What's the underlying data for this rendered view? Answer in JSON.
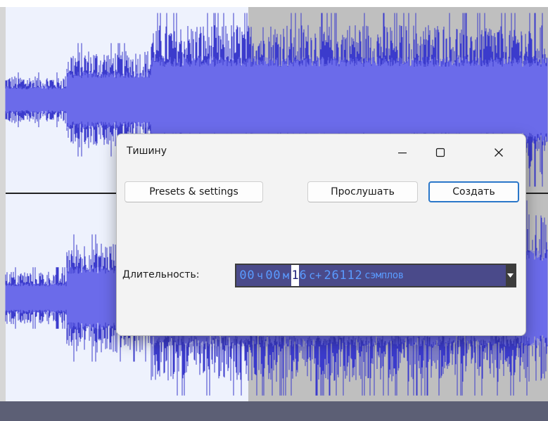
{
  "dialog": {
    "title": "Тишину",
    "presets_label": "Presets & settings",
    "preview_label": "Прослушать",
    "create_label": "Создать",
    "duration_label": "Длительность:"
  },
  "timecode": {
    "hours_digits": [
      "0",
      "0"
    ],
    "hours_unit": "ч",
    "minutes_digits": [
      "0",
      "0"
    ],
    "minutes_unit": "м",
    "seconds_digits": [
      "1",
      "6"
    ],
    "seconds_unit": "с+",
    "samples_digits": [
      "2",
      "6",
      "1",
      "1",
      "2"
    ],
    "samples_unit": "сэмплов",
    "selected_digit": "1"
  },
  "colors": {
    "waveform": "#3b3bcc",
    "waveform_rms": "#6b6bea",
    "selection_background": "#bfbfbf",
    "track_background": "#eef2fd",
    "timecode_background": "#4a4a8a",
    "timecode_text": "#5a9bff",
    "primary_button_border": "#2a77c9"
  },
  "icons": {
    "minimize": "minimize-icon",
    "maximize": "maximize-icon",
    "close": "close-icon",
    "dropdown": "dropdown-arrow-icon"
  }
}
